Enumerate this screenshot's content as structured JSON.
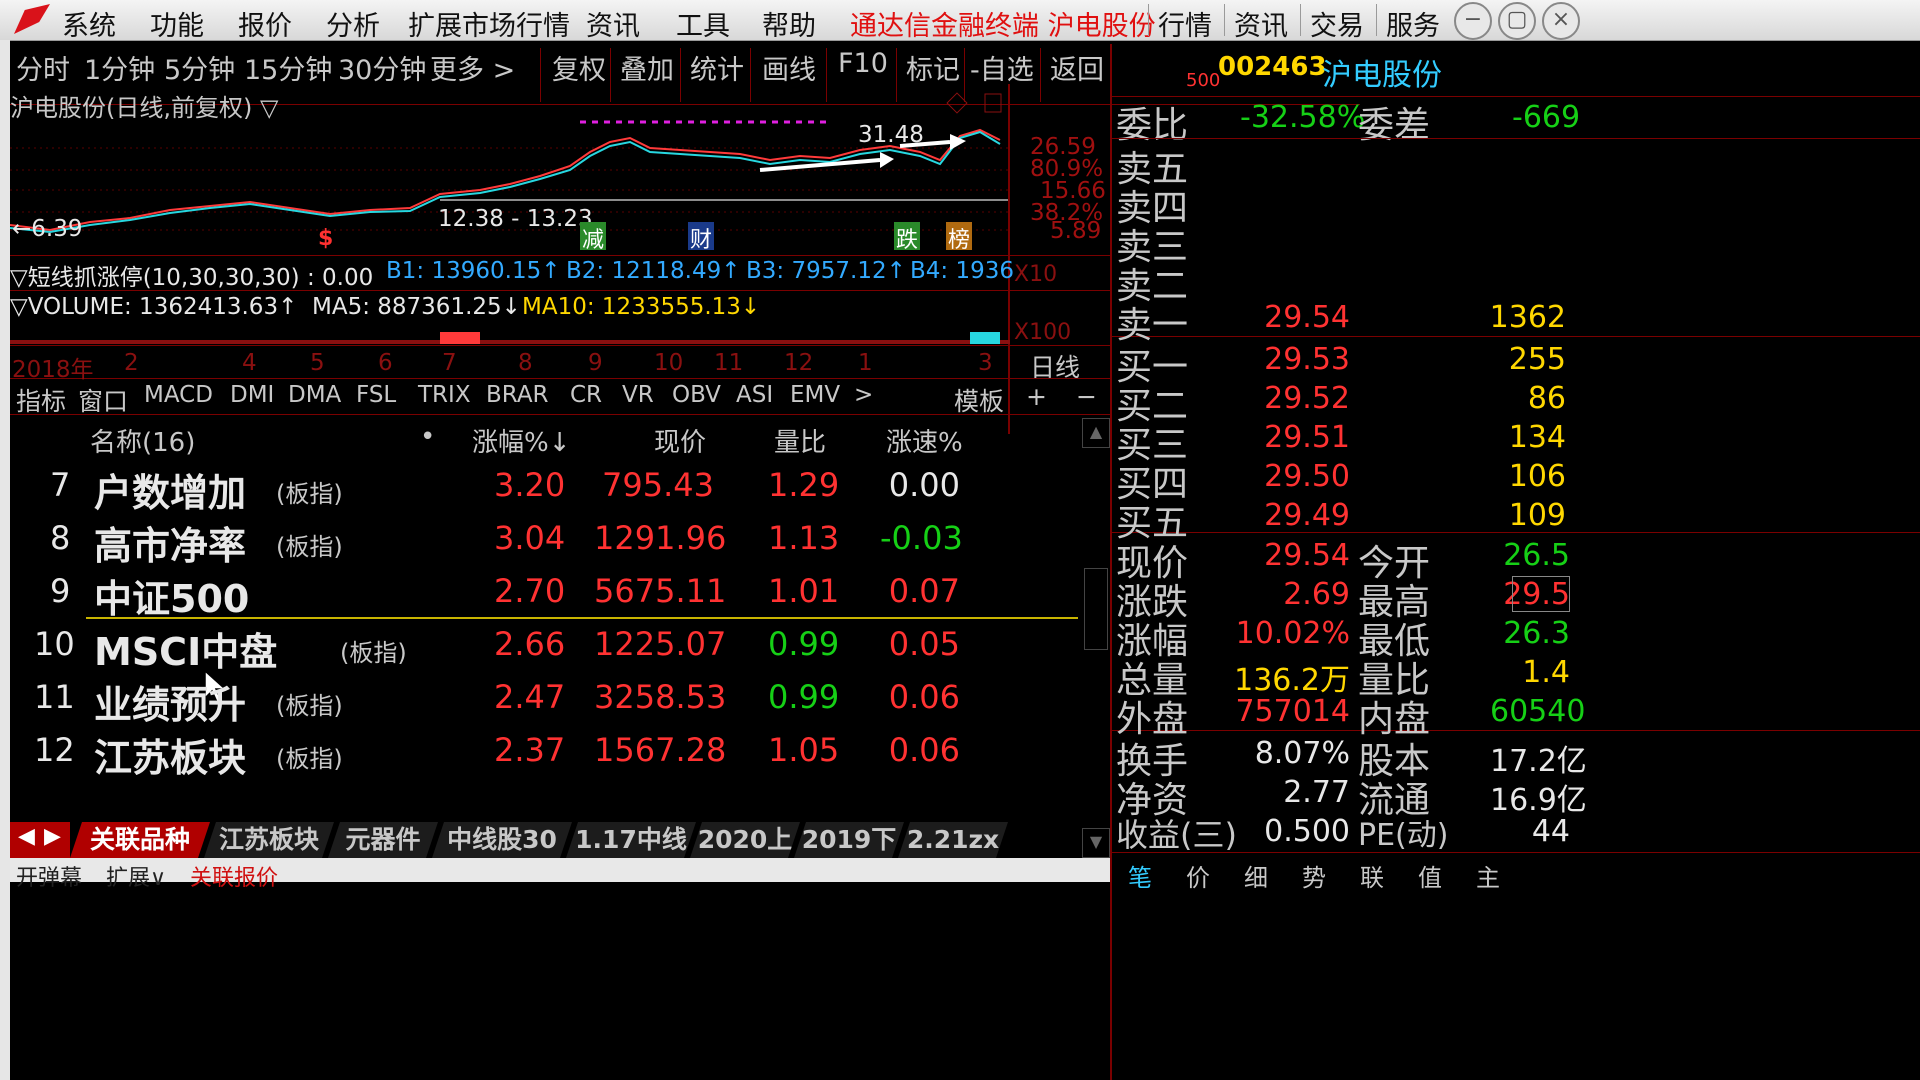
{
  "menubar": {
    "items": [
      "系统",
      "功能",
      "报价",
      "分析",
      "扩展市场行情",
      "资讯",
      "工具",
      "帮助"
    ],
    "app_title": "通达信金融终端 沪电股份",
    "right_items": [
      "行情",
      "资讯",
      "交易",
      "服务"
    ]
  },
  "toolbar": {
    "periods": [
      "分时",
      "1分钟",
      "5分钟",
      "15分钟",
      "30分钟",
      "更多 >"
    ],
    "actions": [
      "复权",
      "叠加",
      "统计",
      "画线",
      "F10",
      "标记",
      "-自选",
      "返回"
    ]
  },
  "chart": {
    "title": "沪电股份(日线,前复权) ▽",
    "price_labels": [
      "26.59",
      "80.9%",
      "15.66",
      "38.2%",
      "5.89"
    ],
    "low_label": "←6.39",
    "range_label": "12.38 - 13.23",
    "high_label": "31.48",
    "markers": [
      {
        "text": "$",
        "color": "#ff3030"
      },
      {
        "text": "减",
        "color": "#2a8a2a"
      },
      {
        "text": "财",
        "color": "#1a3a8a"
      },
      {
        "text": "跌",
        "color": "#2a8a2a"
      },
      {
        "text": "榜",
        "color": "#b06a10"
      }
    ],
    "indicator_line": "▽短线抓涨停(10,30,30,30) : 0.00",
    "b1": "B1: 13960.15↑",
    "b2": "B2: 12118.49↑",
    "b3": "B3: 7957.12↑",
    "b4": "B4: 1936",
    "x10": "X10",
    "volume": "▽VOLUME: 1362413.63↑",
    "ma5": "MA5: 887361.25↓",
    "ma10": "MA10: 1233555.13↓",
    "x100": "X100",
    "axis_labels": [
      "2018年",
      "2",
      "4",
      "5",
      "6",
      "7",
      "8",
      "9",
      "10",
      "11",
      "12",
      "1",
      "3"
    ],
    "period_label": "日线"
  },
  "indicator_tabs": [
    "指标",
    "窗口",
    "MACD",
    "DMI",
    "DMA",
    "FSL",
    "TRIX",
    "BRAR",
    "CR",
    "VR",
    "OBV",
    "ASI",
    "EMV",
    ">"
  ],
  "indicator_right": [
    "模板",
    "+",
    "−"
  ],
  "list": {
    "headers": {
      "name": "名称(16)",
      "dot": "•",
      "change": "涨幅%↓",
      "price": "现价",
      "volratio": "量比",
      "speed": "涨速%"
    },
    "rows": [
      {
        "idx": "7",
        "name": "户数增加",
        "tag": "(板指)",
        "change": "3.20",
        "price": "795.43",
        "volratio": "1.29",
        "speed": "0.00",
        "vr_color": "#ff3232",
        "sp_color": "#e8e8e8"
      },
      {
        "idx": "8",
        "name": "高市净率",
        "tag": "(板指)",
        "change": "3.04",
        "price": "1291.96",
        "volratio": "1.13",
        "speed": "-0.03",
        "vr_color": "#ff3232",
        "sp_color": "#16d016"
      },
      {
        "idx": "9",
        "name": "中证500",
        "tag": "",
        "change": "2.70",
        "price": "5675.11",
        "volratio": "1.01",
        "speed": "0.07",
        "vr_color": "#ff3232",
        "sp_color": "#ff3232"
      },
      {
        "idx": "10",
        "name": "MSCI中盘",
        "tag": "(板指)",
        "change": "2.66",
        "price": "1225.07",
        "volratio": "0.99",
        "speed": "0.05",
        "vr_color": "#16d016",
        "sp_color": "#ff3232"
      },
      {
        "idx": "11",
        "name": "业绩预升",
        "tag": "(板指)",
        "change": "2.47",
        "price": "3258.53",
        "volratio": "0.99",
        "speed": "0.06",
        "vr_color": "#16d016",
        "sp_color": "#ff3232"
      },
      {
        "idx": "12",
        "name": "江苏板块",
        "tag": "(板指)",
        "change": "2.37",
        "price": "1567.28",
        "volratio": "1.05",
        "speed": "0.06",
        "vr_color": "#ff3232",
        "sp_color": "#ff3232"
      }
    ]
  },
  "bottom_tabs": [
    "关联品种",
    "江苏板块",
    "元器件",
    "中线股30",
    "1.17中线",
    "2020上",
    "2019下",
    "2.21zx"
  ],
  "status_bar": [
    "开弹幕",
    "扩展∨",
    "关联报价"
  ],
  "stock": {
    "prefix": "500",
    "code": "002463",
    "name": "沪电股份",
    "weibi_label": "委比",
    "weibi": "-32.58%",
    "weicha_label": "委差",
    "weicha": "-669",
    "sell": [
      {
        "label": "卖五",
        "price": "",
        "vol": ""
      },
      {
        "label": "卖四",
        "price": "",
        "vol": ""
      },
      {
        "label": "卖三",
        "price": "",
        "vol": ""
      },
      {
        "label": "卖二",
        "price": "",
        "vol": ""
      },
      {
        "label": "卖一",
        "price": "29.54",
        "vol": "1362"
      }
    ],
    "buy": [
      {
        "label": "买一",
        "price": "29.53",
        "vol": "255"
      },
      {
        "label": "买二",
        "price": "29.52",
        "vol": "86"
      },
      {
        "label": "买三",
        "price": "29.51",
        "vol": "134"
      },
      {
        "label": "买四",
        "price": "29.50",
        "vol": "106"
      },
      {
        "label": "买五",
        "price": "29.49",
        "vol": "109"
      }
    ],
    "quote": [
      {
        "l1": "现价",
        "v1": "29.54",
        "c1": "#ff3232",
        "l2": "今开",
        "v2": "26.5",
        "c2": "#16d016"
      },
      {
        "l1": "涨跌",
        "v1": "2.69",
        "c1": "#ff3232",
        "l2": "最高",
        "v2": "29.5",
        "c2": "#ff3232"
      },
      {
        "l1": "涨幅",
        "v1": "10.02%",
        "c1": "#ff3232",
        "l2": "最低",
        "v2": "26.3",
        "c2": "#16d016"
      },
      {
        "l1": "总量",
        "v1": "136.2万",
        "c1": "#ffd700",
        "l2": "量比",
        "v2": "1.4",
        "c2": "#ffd700"
      },
      {
        "l1": "外盘",
        "v1": "757014",
        "c1": "#ff3232",
        "l2": "内盘",
        "v2": "60540",
        "c2": "#16d016"
      }
    ],
    "fundamentals": [
      {
        "l1": "换手",
        "v1": "8.07%",
        "l2": "股本",
        "v2": "17.2亿"
      },
      {
        "l1": "净资",
        "v1": "2.77",
        "l2": "流通",
        "v2": "16.9亿"
      },
      {
        "l1": "收益(三)",
        "v1": "0.500",
        "l2": "PE(动)",
        "v2": "44"
      }
    ],
    "bottom_tabs": [
      "笔",
      "价",
      "细",
      "势",
      "联",
      "值",
      "主"
    ]
  },
  "colors": {
    "up": "#ff3232",
    "down": "#16d016",
    "accent": "#7a0000"
  }
}
